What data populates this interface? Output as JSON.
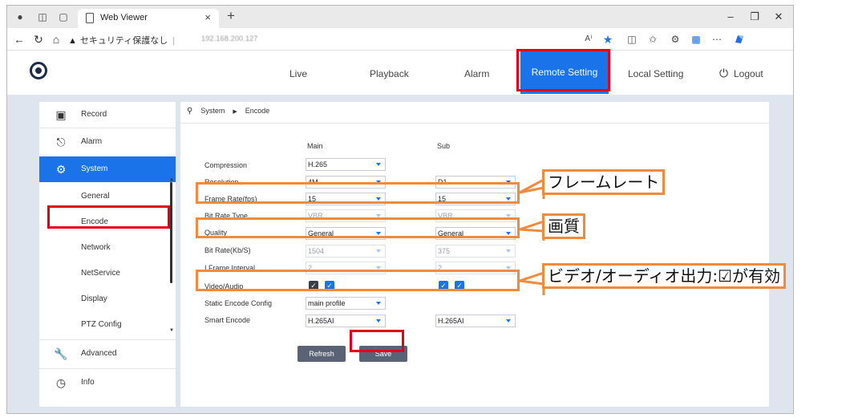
{
  "browser": {
    "tab_title": "Web Viewer",
    "tab_close": "×",
    "new_tab": "+",
    "window_min": "–",
    "window_restore": "❐",
    "window_close": "✕",
    "security_label": "セキュリティ保護なし",
    "url": "192.168.200.127",
    "icons": [
      "profile-icon",
      "workspaces-icon",
      "tab-actions-icon",
      "page-icon",
      "back-icon",
      "refresh-icon",
      "home-icon",
      "warning-icon",
      "read-aloud-icon",
      "favorite-star-icon",
      "split-screen-icon",
      "favorites-icon",
      "extensions-icon",
      "collections-icon",
      "more-icon",
      "copilot-icon"
    ]
  },
  "app": {
    "nav": {
      "live": "Live",
      "playback": "Playback",
      "alarm": "Alarm",
      "remote_setting": "Remote Setting",
      "local_setting": "Local Setting",
      "logout": "Logout"
    },
    "accent": "#1a73e8"
  },
  "sidebar": {
    "items": [
      {
        "label": "Record",
        "icon": "camera-icon"
      },
      {
        "label": "Alarm",
        "icon": "alarm-icon"
      },
      {
        "label": "System",
        "icon": "gear-icon",
        "active": true
      },
      {
        "label": "General"
      },
      {
        "label": "Encode",
        "selected": true
      },
      {
        "label": "Network"
      },
      {
        "label": "NetService"
      },
      {
        "label": "Display"
      },
      {
        "label": "PTZ Config"
      },
      {
        "label": "Advanced",
        "icon": "wrench-icon"
      },
      {
        "label": "Info",
        "icon": "info-icon"
      }
    ]
  },
  "breadcrumb": {
    "root": "System",
    "current": "Encode"
  },
  "form": {
    "columns": {
      "main": "Main",
      "sub": "Sub"
    },
    "rows": [
      {
        "label": "Compression",
        "main": "H.265"
      },
      {
        "label": "Resolution",
        "main": "4M",
        "sub": "D1"
      },
      {
        "label": "Frame Rate(fps)",
        "main": "15",
        "sub": "15"
      },
      {
        "label": "Bit Rate Type",
        "main": "VBR",
        "sub": "VBR"
      },
      {
        "label": "Quality",
        "main": "General",
        "sub": "General"
      },
      {
        "label": "Bit Rate(Kb/S)",
        "main": "1504",
        "sub": "375"
      },
      {
        "label": "I Frame Interval",
        "main": "2",
        "sub": "2"
      },
      {
        "label": "Video/Audio"
      },
      {
        "label": "Static Encode Config",
        "main": "main profile"
      },
      {
        "label": "Smart Encode",
        "main": "H.265AI",
        "sub": "H.265AI"
      }
    ],
    "checkbox_mark": "✓",
    "buttons": {
      "refresh": "Refresh",
      "save": "Save"
    }
  },
  "annotations": {
    "frame_rate": "フレームレート",
    "quality": "画質",
    "video_audio": "ビデオ/オーディオ出力:☑が有効"
  }
}
